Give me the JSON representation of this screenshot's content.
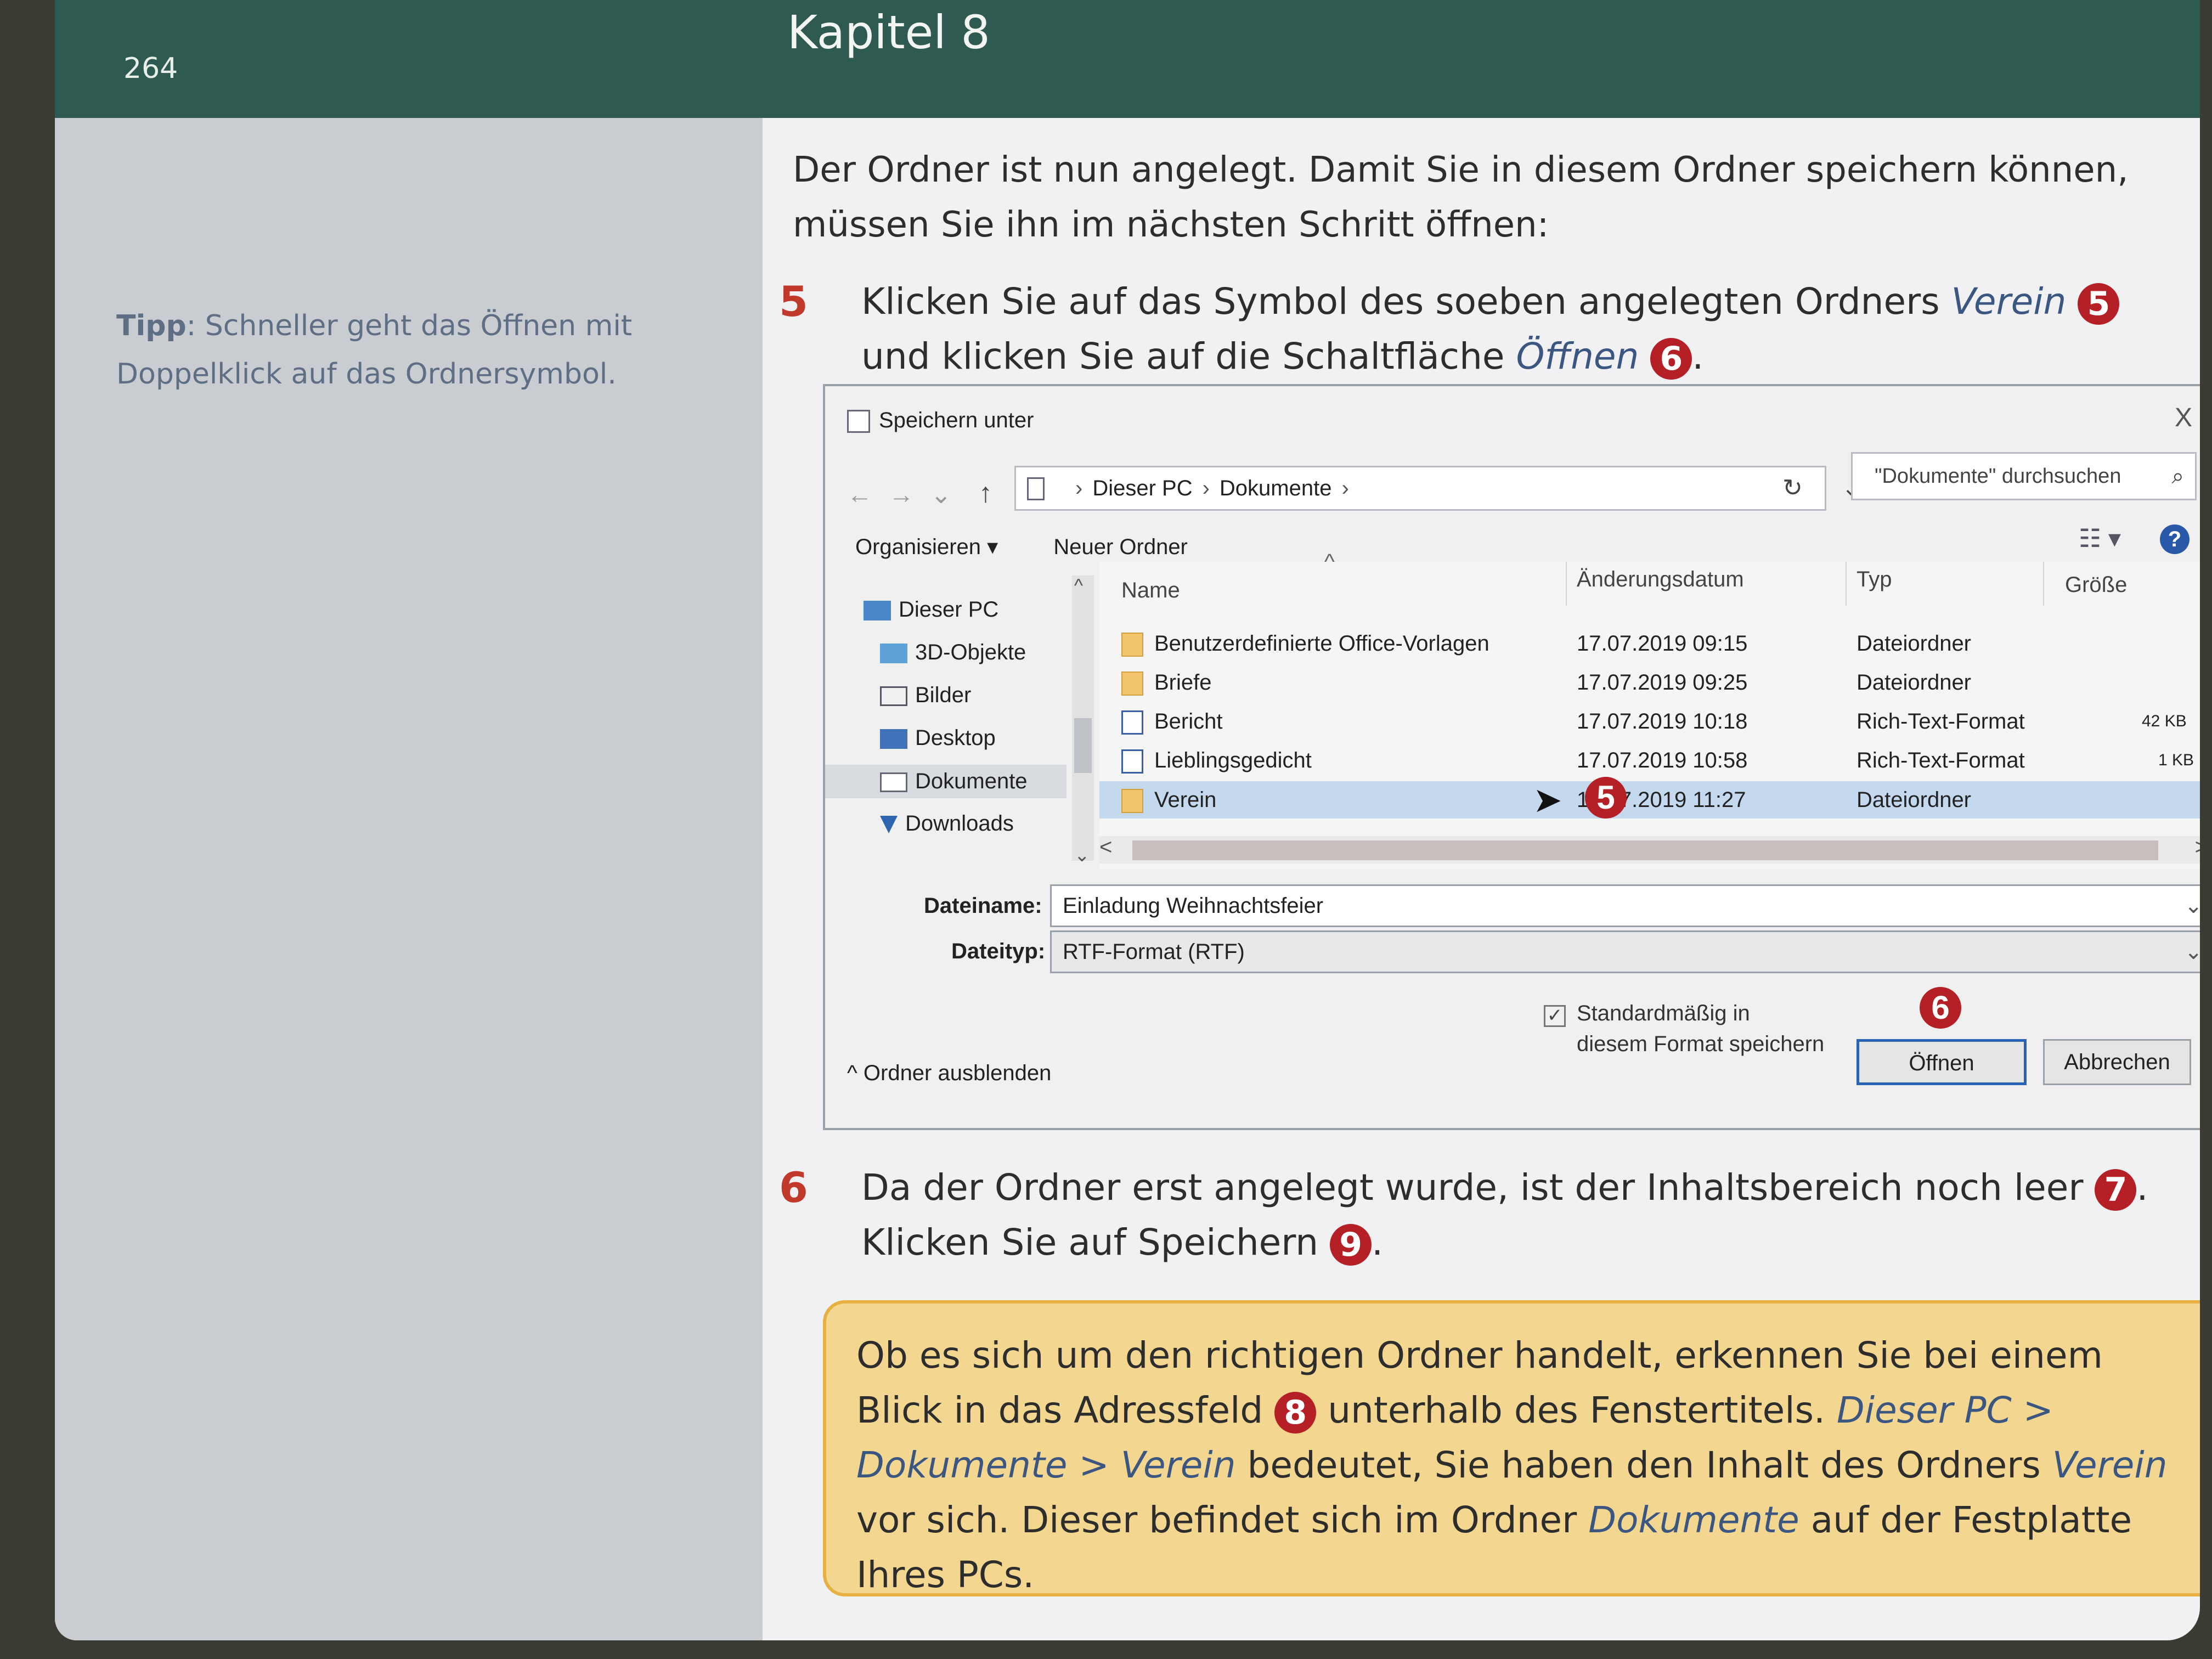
{
  "page": {
    "number": "264",
    "chapter": "Kapitel 8"
  },
  "tip": {
    "label": "Tipp",
    "text": ": Schneller geht das Öffnen mit Doppelklick auf das Ordnersymbol."
  },
  "intro": "Der Ordner ist nun angelegt. Damit Sie in diesem Ordner speichern können, müssen Sie ihn im nächsten Schritt öffnen:",
  "step5": {
    "num": "5",
    "text_a": "Klicken Sie auf das Symbol des soeben angelegten Ordners ",
    "em_a": "Verein",
    "badge_a": "5",
    "text_b": " und klicken Sie auf die Schaltfläche ",
    "em_b": "Öffnen",
    "badge_b": "6",
    "text_c": "."
  },
  "dialog": {
    "title": "Speichern unter",
    "close": "X",
    "nav_back": "←",
    "nav_forward": "→",
    "nav_recent": "⌄",
    "nav_up": "↑",
    "address": [
      "Dieser PC",
      "Dokumente"
    ],
    "address_sep": "›",
    "address_dropdown": "⌄",
    "refresh": "↻",
    "search_placeholder": "\"Dokumente\" durchsuchen",
    "search_icon": "⌕",
    "toolbar": {
      "organize": "Organisieren ▾",
      "new_folder": "Neuer Ordner"
    },
    "view_icon": "☷ ▾",
    "help": "?",
    "nav_items": [
      {
        "label": "Dieser PC",
        "icon": "pc-icon"
      },
      {
        "label": "3D-Objekte",
        "icon": "cube-icon"
      },
      {
        "label": "Bilder",
        "icon": "pictures-icon"
      },
      {
        "label": "Desktop",
        "icon": "desktop-icon"
      },
      {
        "label": "Dokumente",
        "icon": "documents-icon"
      },
      {
        "label": "Downloads",
        "icon": "download-icon"
      }
    ],
    "columns": {
      "name": "Name",
      "date": "Änderungsdatum",
      "type": "Typ",
      "size": "Größe"
    },
    "sort_caret": "^",
    "files": [
      {
        "name": "Benutzerdefinierte Office-Vorlagen",
        "date": "17.07.2019 09:15",
        "type": "Dateiordner",
        "size": "",
        "icon": "folder-icon"
      },
      {
        "name": "Briefe",
        "date": "17.07.2019 09:25",
        "type": "Dateiordner",
        "size": "",
        "icon": "folder-icon"
      },
      {
        "name": "Bericht",
        "date": "17.07.2019 10:18",
        "type": "Rich-Text-Format",
        "size": "42 KB",
        "icon": "document-icon"
      },
      {
        "name": "Lieblingsgedicht",
        "date": "17.07.2019 10:58",
        "type": "Rich-Text-Format",
        "size": "1 KB",
        "icon": "document-icon"
      },
      {
        "name": "Verein",
        "date": "17.07.2019 11:27",
        "type": "Dateiordner",
        "size": "",
        "icon": "folder-icon"
      }
    ],
    "row_badge": "5",
    "filename_label": "Dateiname:",
    "filename_value": "Einladung Weihnachtsfeier",
    "filetype_label": "Dateityp:",
    "filetype_value": "RTF-Format (RTF)",
    "dropdown": "⌄",
    "default_format_line1": "Standardmäßig in",
    "default_format_line2": "diesem Format speichern",
    "checkmark": "✓",
    "open_badge": "6",
    "open_button": "Öffnen",
    "cancel_button": "Abbrechen",
    "hide_folders": "^  Ordner ausblenden",
    "scroll_left": "<",
    "scroll_right": ">",
    "scroll_up": "^",
    "scroll_down": "⌄"
  },
  "step6": {
    "num": "6",
    "text_a": "Da der Ordner erst angelegt wurde, ist der Inhaltsbereich noch leer ",
    "badge_a": "7",
    "text_b": ". Klicken Sie auf Speichern ",
    "badge_b": "9",
    "text_c": "."
  },
  "box": {
    "text_a": "Ob es sich um den richtigen Ordner handelt, erkennen Sie bei einem Blick in das Adressfeld ",
    "badge": "8",
    "text_b": " unterhalb des Fenstertitels. ",
    "em_a": "Dieser PC > Dokumente > Verein",
    "text_c": " bedeutet, Sie haben den Inhalt des Ordners ",
    "em_b": "Verein",
    "text_d": " vor sich. Dieser befindet sich im Ordner ",
    "em_c": "Dokumente",
    "text_e": " auf der Festplatte Ihres PCs."
  }
}
